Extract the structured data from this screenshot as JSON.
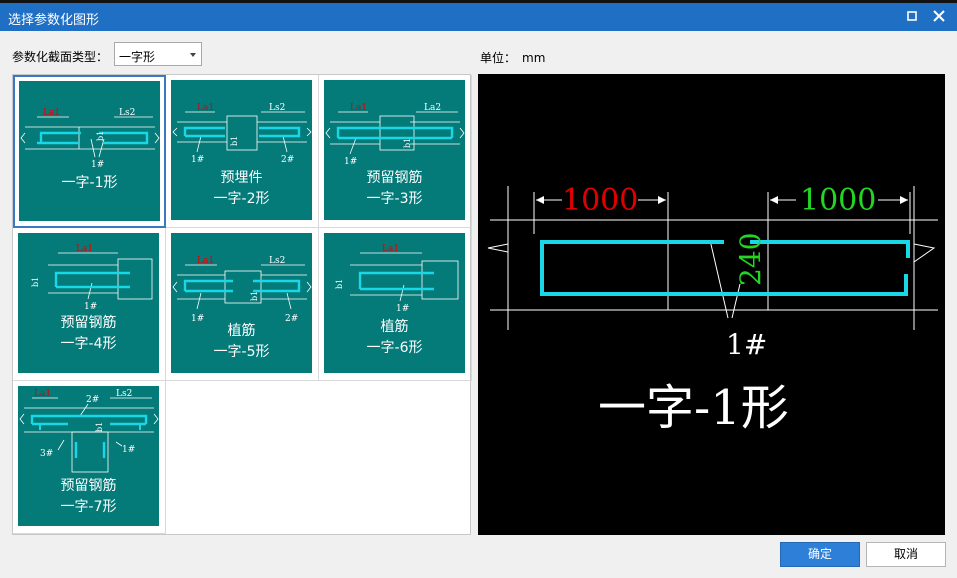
{
  "window": {
    "title": "选择参数化图形"
  },
  "section_type": {
    "label": "参数化截面类型：",
    "selected": "一字形"
  },
  "unit": {
    "label": "单位：",
    "value": "mm"
  },
  "shapes": [
    {
      "caption": [
        "一字-1形"
      ],
      "labels": [
        "La1",
        "Ls2",
        "b1",
        "1#"
      ]
    },
    {
      "caption": [
        "预埋件",
        "一字-2形"
      ],
      "labels": [
        "La1",
        "Ls2",
        "b1",
        "1#",
        "2#"
      ]
    },
    {
      "caption": [
        "预留钢筋",
        "一字-3形"
      ],
      "labels": [
        "La1",
        "La2",
        "b1",
        "1#"
      ]
    },
    {
      "caption": [
        "预留钢筋",
        "一字-4形"
      ],
      "labels": [
        "La1",
        "b1",
        "1#"
      ]
    },
    {
      "caption": [
        "植筋",
        "一字-5形"
      ],
      "labels": [
        "La1",
        "Ls2",
        "b1",
        "1#",
        "2#"
      ]
    },
    {
      "caption": [
        "植筋",
        "一字-6形"
      ],
      "labels": [
        "La1",
        "b1",
        "1#"
      ]
    },
    {
      "caption": [
        "预留钢筋",
        "一字-7形"
      ],
      "labels": [
        "La1",
        "Ls2",
        "b1",
        "1#",
        "2#",
        "3#"
      ]
    }
  ],
  "selected_index": 0,
  "preview": {
    "left_dim": "1000",
    "right_dim": "1000",
    "width_dim": "240",
    "bar_label": "1#",
    "caption": "一字-1形",
    "colors": {
      "left_dim": "#e00000",
      "right_dim": "#22d622",
      "width_dim": "#22d622",
      "rebar": "#18d8e8",
      "line": "#ffffff"
    }
  },
  "buttons": {
    "ok": "确定",
    "cancel": "取消"
  },
  "colors": {
    "titlebar": "#1f6fc5",
    "tile": "#047a79",
    "selection": "#3a78c4",
    "ok_button": "#2e7fd8"
  },
  "icons": {
    "maximize": "maximize-icon",
    "close": "close-icon",
    "dropdown": "chevron-down-icon"
  }
}
